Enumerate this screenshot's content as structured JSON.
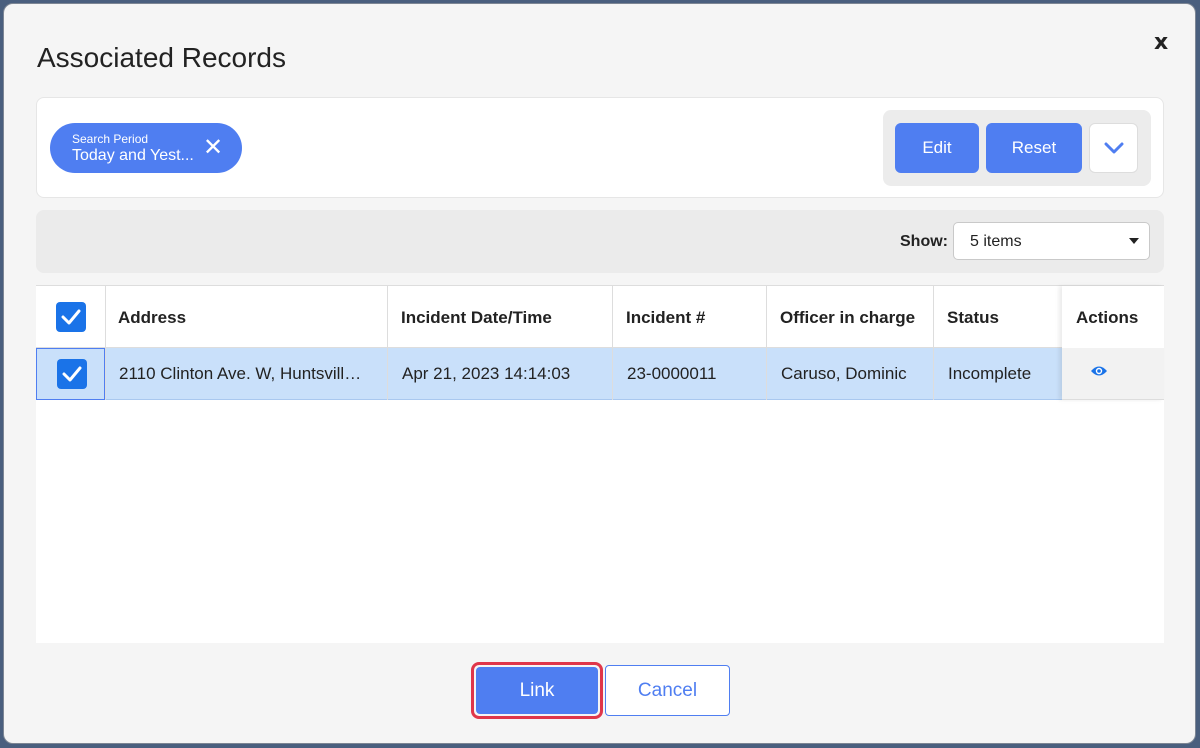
{
  "dialog": {
    "title": "Associated Records",
    "close_label": "x"
  },
  "filters": {
    "chip": {
      "label": "Search Period",
      "value": "Today and Yest..."
    },
    "edit_label": "Edit",
    "reset_label": "Reset"
  },
  "pager": {
    "show_label": "Show:",
    "selected": "5 items"
  },
  "table": {
    "columns": [
      "Address",
      "Incident Date/Time",
      "Incident #",
      "Officer in charge",
      "Status",
      "Actions"
    ],
    "rows": [
      {
        "address": "2110 Clinton Ave. W, Huntsvill…",
        "datetime": "Apr 21, 2023 14:14:03",
        "incident": "23-0000011",
        "officer": "Caruso, Dominic",
        "status": "Incomplete",
        "checked": true
      }
    ],
    "header_checked": true
  },
  "footer": {
    "link_label": "Link",
    "cancel_label": "Cancel"
  },
  "colors": {
    "accent": "#4f7ef1",
    "checkbox": "#1a73e8",
    "row_selected": "#c9e0fa",
    "highlight_border": "#e0364a"
  },
  "icons": [
    "close-icon",
    "chevron-down-icon",
    "caret-down-icon",
    "check-icon",
    "eye-icon"
  ]
}
